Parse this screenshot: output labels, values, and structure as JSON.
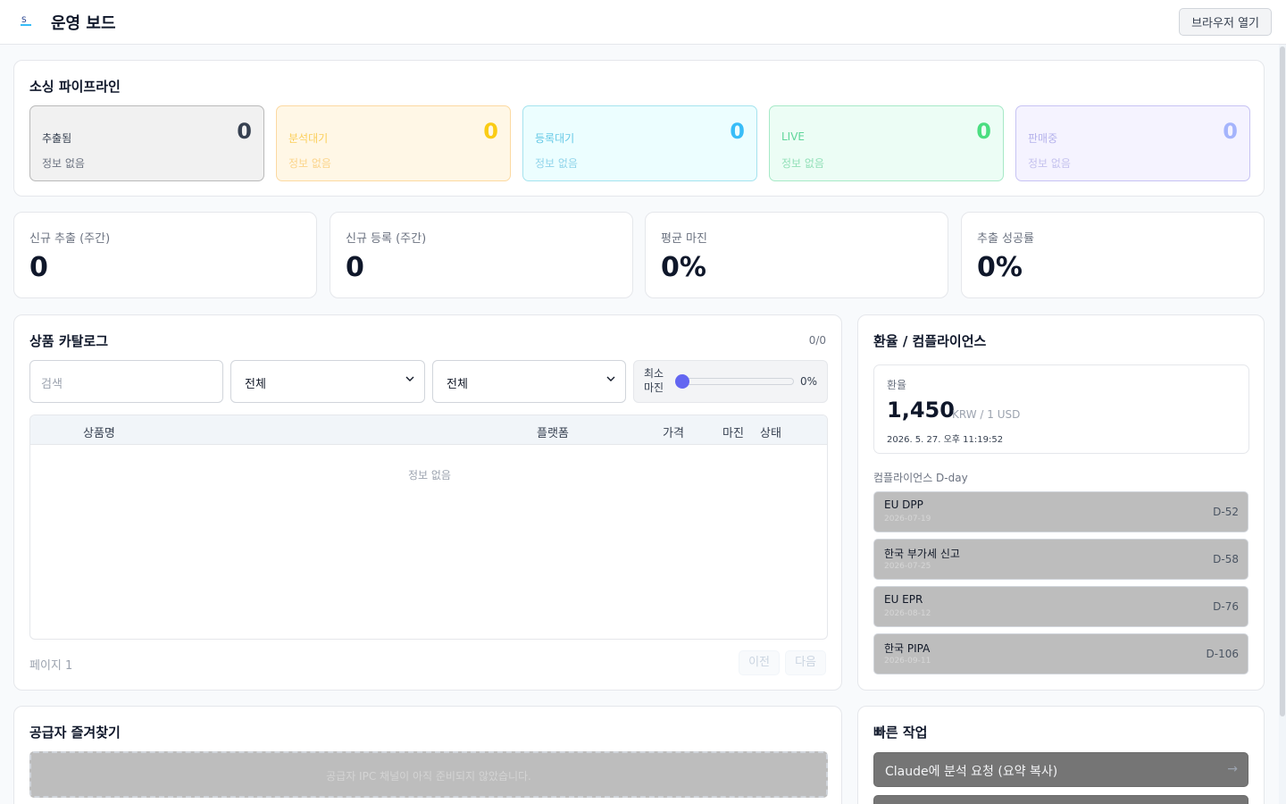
{
  "app": {
    "title": "운영 보드",
    "open_browser_label": "브라우저 열기"
  },
  "pipeline": {
    "title": "소싱 파이프라인",
    "stages": [
      {
        "label": "추출됨",
        "count": "0",
        "info": "정보 없음",
        "color": "#374151",
        "bg": "#f1f1f1",
        "border": "#b9b9b9"
      },
      {
        "label": "분석대기",
        "count": "0",
        "info": "정보 없음",
        "color": "#facc15",
        "bg": "#fff7e6",
        "border": "#fcd9a1"
      },
      {
        "label": "등록대기",
        "count": "0",
        "info": "정보 없음",
        "color": "#38bdf8",
        "bg": "#ecfeff",
        "border": "#a5e3ee"
      },
      {
        "label": "LIVE",
        "count": "0",
        "info": "정보 없음",
        "color": "#4ade80",
        "bg": "#ecfdf5",
        "border": "#a7e9c7"
      },
      {
        "label": "판매중",
        "count": "0",
        "info": "정보 없음",
        "color": "#a5b4fc",
        "bg": "#f5f3ff",
        "border": "#c7c3f3"
      }
    ]
  },
  "kpis": [
    {
      "label": "신규 추출 (주간)",
      "value": "0"
    },
    {
      "label": "신규 등록 (주간)",
      "value": "0"
    },
    {
      "label": "평균 마진",
      "value": "0%"
    },
    {
      "label": "추출 성공률",
      "value": "0%"
    }
  ],
  "catalog": {
    "title": "상품 카탈로그",
    "count": "0/0",
    "search_placeholder": "검색",
    "filter1_value": "전체",
    "filter2_value": "전체",
    "min_margin_label": "최소\n마진",
    "min_margin_value": "0%",
    "min_margin_fraction": 0,
    "columns": [
      "상품명",
      "플랫폼",
      "가격",
      "마진",
      "상태"
    ],
    "empty_text": "정보 없음",
    "page_label": "페이지 1",
    "prev_label": "이전",
    "next_label": "다음"
  },
  "fx": {
    "title": "환율 / 컴플라이언스",
    "rate_label": "환율",
    "rate_value": "1,450",
    "rate_unit": "KRW / 1 USD",
    "rate_time": "2026. 5. 27. 오후 11:19:52",
    "compliance_label": "컴플라이언스 D-day",
    "ddays": [
      {
        "name": "EU DPP",
        "date": "2026-07-19",
        "dday": "D-52"
      },
      {
        "name": "한국 부가세 신고",
        "date": "2026-07-25",
        "dday": "D-58"
      },
      {
        "name": "EU EPR",
        "date": "2026-08-12",
        "dday": "D-76"
      },
      {
        "name": "한국 PIPA",
        "date": "2026-09-11",
        "dday": "D-106"
      }
    ]
  },
  "suppliers": {
    "title": "공급자 즐겨찾기",
    "empty_text": "공급자 IPC 채널이 아직 준비되지 않았습니다."
  },
  "quick": {
    "title": "빠른 작업",
    "action1_label": "Claude에 분석 요청 (요약 복사)",
    "action1_arrow": "→"
  }
}
